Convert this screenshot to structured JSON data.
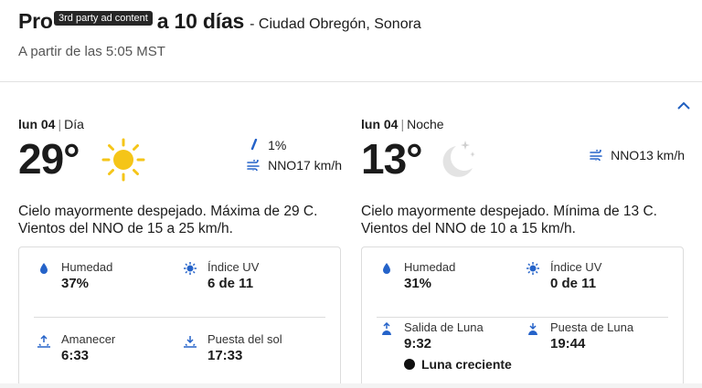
{
  "header": {
    "title": "Pronóstico para 10 días",
    "title_visible_start": "Pro",
    "title_visible_end": "a 10 días",
    "location": "- Ciudad Obregón, Sonora",
    "tooltip": "3rd party ad content",
    "subtitle": "A partir de las 5:05 MST"
  },
  "day": {
    "date": "lun 04",
    "period": "Día",
    "temp": "29°",
    "icon": "sun-icon",
    "precip": "1%",
    "wind": "NNO17 km/h",
    "description": "Cielo mayormente despejado. Máxima de 29 C. Vientos del NNO de 15 a 25 km/h.",
    "details": {
      "humidity_label": "Humedad",
      "humidity_value": "37%",
      "uv_label": "Índice UV",
      "uv_value": "6 de 11",
      "sunrise_label": "Amanecer",
      "sunrise_value": "6:33",
      "sunset_label": "Puesta del sol",
      "sunset_value": "17:33"
    }
  },
  "night": {
    "date": "lun 04",
    "period": "Noche",
    "temp": "13°",
    "icon": "moon-stars-icon",
    "wind": "NNO13 km/h",
    "description": "Cielo mayormente despejado. Mínima de 13 C. Vientos del NNO de 10 a 15 km/h.",
    "details": {
      "humidity_label": "Humedad",
      "humidity_value": "31%",
      "uv_label": "Índice UV",
      "uv_value": "0 de 11",
      "moonrise_label": "Salida de Luna",
      "moonrise_value": "9:32",
      "moonset_label": "Puesta de Luna",
      "moonset_value": "19:44",
      "moon_phase": "Luna creciente"
    }
  },
  "colors": {
    "accent": "#2563c9",
    "sun": "#f5c518",
    "text": "#1b1b1b"
  }
}
